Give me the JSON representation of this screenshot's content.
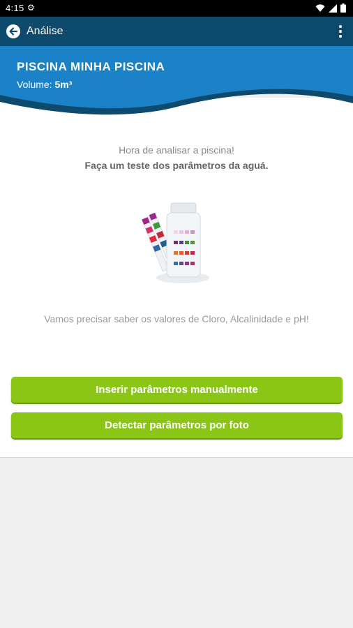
{
  "status_bar": {
    "time": "4:15",
    "icons": [
      "gear-icon",
      "wifi-icon",
      "signal-icon",
      "battery-icon"
    ]
  },
  "app_bar": {
    "title": "Análise",
    "back_icon": "arrow-left-icon",
    "menu_icon": "more-vert-icon"
  },
  "header": {
    "pool_name": "PISCINA MINHA PISCINA",
    "volume_label": "Volume:",
    "volume_value": "5m³"
  },
  "main": {
    "line1": "Hora de analisar a piscina!",
    "line2": "Faça um teste dos parâmetros da aguá.",
    "line3": "Vamos precisar saber os valores de Cloro, Alcalinidade e pH!",
    "illustration_icon": "test-strip-bottle-icon"
  },
  "buttons": {
    "manual": "Inserir parâmetros manualmente",
    "photo": "Detectar parâmetros por foto"
  },
  "colors": {
    "app_bar": "#0e4a6d",
    "header": "#1c82c8",
    "button": "#8bc516"
  }
}
